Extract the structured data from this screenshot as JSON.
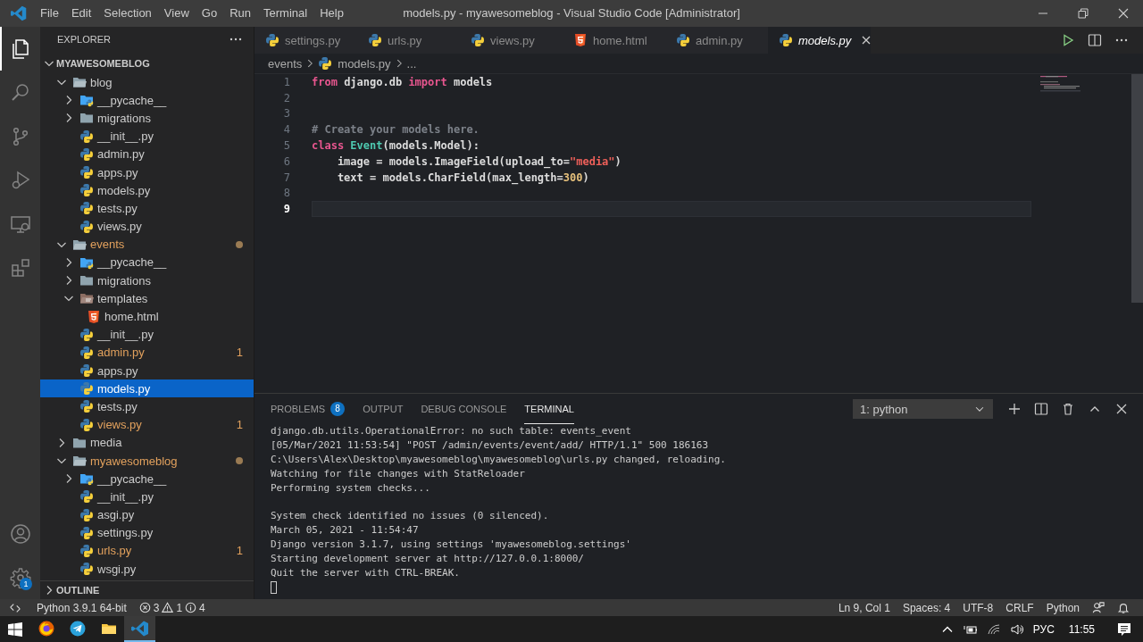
{
  "title_bar": {
    "menu": [
      "File",
      "Edit",
      "Selection",
      "View",
      "Go",
      "Run",
      "Terminal",
      "Help"
    ],
    "title": "models.py - myawesomeblog - Visual Studio Code [Administrator]"
  },
  "activity_bar": {
    "items": [
      {
        "kind": "explorer",
        "selected": true
      },
      {
        "kind": "search",
        "selected": false
      },
      {
        "kind": "source-control",
        "selected": false
      },
      {
        "kind": "run",
        "selected": false
      },
      {
        "kind": "remote",
        "selected": false
      },
      {
        "kind": "extensions",
        "selected": false
      }
    ],
    "bottom": [
      {
        "kind": "account"
      },
      {
        "kind": "manage",
        "badge": "1"
      }
    ]
  },
  "sidebar": {
    "title": "EXPLORER",
    "section": {
      "title": "MYAWESOMEBLOG",
      "expanded": true
    },
    "tree": [
      {
        "name": "blog",
        "kind": "folder",
        "expanded": true,
        "modified": false,
        "selected": false,
        "children": [
          {
            "name": "__pycache__",
            "kind": "pycache",
            "expanded": false,
            "modified": false,
            "selected": false
          },
          {
            "name": "migrations",
            "kind": "folder",
            "expanded": false,
            "modified": false,
            "selected": false
          },
          {
            "name": "__init__.py",
            "kind": "python",
            "modified": false,
            "selected": false
          },
          {
            "name": "admin.py",
            "kind": "python",
            "modified": false,
            "selected": false
          },
          {
            "name": "apps.py",
            "kind": "python",
            "modified": false,
            "selected": false
          },
          {
            "name": "models.py",
            "kind": "python",
            "modified": false,
            "selected": false
          },
          {
            "name": "tests.py",
            "kind": "python",
            "modified": false,
            "selected": false
          },
          {
            "name": "views.py",
            "kind": "python",
            "modified": false,
            "selected": false
          }
        ]
      },
      {
        "name": "events",
        "kind": "folder",
        "expanded": true,
        "modified": true,
        "selected": false,
        "children": [
          {
            "name": "__pycache__",
            "kind": "pycache",
            "expanded": false,
            "modified": false,
            "selected": false
          },
          {
            "name": "migrations",
            "kind": "folder",
            "expanded": false,
            "modified": false,
            "selected": false
          },
          {
            "name": "templates",
            "kind": "templates",
            "expanded": true,
            "modified": false,
            "selected": false,
            "children": [
              {
                "name": "home.html",
                "kind": "html",
                "modified": false,
                "selected": false
              }
            ]
          },
          {
            "name": "__init__.py",
            "kind": "python",
            "modified": false,
            "selected": false
          },
          {
            "name": "admin.py",
            "kind": "python",
            "modified": true,
            "badge": "1",
            "selected": false
          },
          {
            "name": "apps.py",
            "kind": "python",
            "modified": false,
            "selected": false
          },
          {
            "name": "models.py",
            "kind": "python",
            "modified": false,
            "selected": true
          },
          {
            "name": "tests.py",
            "kind": "python",
            "modified": false,
            "selected": false
          },
          {
            "name": "views.py",
            "kind": "python",
            "modified": true,
            "badge": "1",
            "selected": false
          }
        ]
      },
      {
        "name": "media",
        "kind": "folder",
        "expanded": false,
        "modified": false,
        "selected": false
      },
      {
        "name": "myawesomeblog",
        "kind": "folder",
        "expanded": true,
        "modified": true,
        "selected": false,
        "children": [
          {
            "name": "__pycache__",
            "kind": "pycache",
            "expanded": false,
            "modified": false,
            "selected": false
          },
          {
            "name": "__init__.py",
            "kind": "python",
            "modified": false,
            "selected": false
          },
          {
            "name": "asgi.py",
            "kind": "python",
            "modified": false,
            "selected": false
          },
          {
            "name": "settings.py",
            "kind": "python",
            "modified": false,
            "selected": false
          },
          {
            "name": "urls.py",
            "kind": "python",
            "modified": true,
            "badge": "1",
            "selected": false
          },
          {
            "name": "wsgi.py",
            "kind": "python",
            "modified": false,
            "selected": false
          }
        ]
      }
    ],
    "outline": {
      "title": "OUTLINE",
      "expanded": false
    }
  },
  "editor": {
    "tabs": [
      {
        "label": "settings.py",
        "kind": "python",
        "selected": false,
        "preview": false
      },
      {
        "label": "urls.py",
        "kind": "python",
        "selected": false,
        "preview": false
      },
      {
        "label": "views.py",
        "kind": "python",
        "selected": false,
        "preview": false
      },
      {
        "label": "home.html",
        "kind": "html",
        "selected": false,
        "preview": false
      },
      {
        "label": "admin.py",
        "kind": "python",
        "selected": false,
        "preview": false
      },
      {
        "label": "models.py",
        "kind": "python",
        "selected": true,
        "preview": true
      }
    ],
    "breadcrumbs": [
      {
        "text": "events",
        "kind": "folder"
      },
      {
        "text": "models.py",
        "kind": "python"
      },
      {
        "text": "...",
        "kind": "symbol"
      }
    ],
    "lines": [
      {
        "number": "1",
        "current": false,
        "tokens": [
          {
            "kind": "keyword",
            "text": "from"
          },
          {
            "kind": "plain",
            "text": " django.db "
          },
          {
            "kind": "keyword",
            "text": "import"
          },
          {
            "kind": "plain",
            "text": " models"
          }
        ]
      },
      {
        "number": "2",
        "current": false
      },
      {
        "number": "3",
        "current": false
      },
      {
        "number": "4",
        "current": false,
        "tokens": [
          {
            "kind": "comment",
            "text": "# Create your models here."
          }
        ]
      },
      {
        "number": "5",
        "current": false,
        "tokens": [
          {
            "kind": "keyword",
            "text": "class"
          },
          {
            "kind": "class",
            "text": " Event"
          },
          {
            "kind": "plain",
            "text": "(models.Model):"
          }
        ]
      },
      {
        "number": "6",
        "current": false,
        "tokens": [
          {
            "kind": "plain",
            "text": "    image = models.ImageField(upload_to="
          },
          {
            "kind": "string",
            "text": "\"media\""
          },
          {
            "kind": "plain",
            "text": ")"
          }
        ]
      },
      {
        "number": "7",
        "current": false,
        "tokens": [
          {
            "kind": "plain",
            "text": "    text = models.CharField(max_length="
          },
          {
            "kind": "number",
            "text": "300"
          },
          {
            "kind": "plain",
            "text": ")"
          }
        ]
      },
      {
        "number": "8",
        "current": false
      },
      {
        "number": "9",
        "current": true
      }
    ]
  },
  "panel": {
    "tabs": [
      {
        "label": "PROBLEMS",
        "badge": "8",
        "selected": false
      },
      {
        "label": "OUTPUT",
        "selected": false
      },
      {
        "label": "DEBUG CONSOLE",
        "selected": false
      },
      {
        "label": "TERMINAL",
        "selected": true
      }
    ],
    "terminal_selector": "1: python",
    "terminal": {
      "cursor": true,
      "lines": [
        {
          "kind": "output",
          "text": "django.db.utils.OperationalError: no such table: events_event"
        },
        {
          "kind": "output",
          "text": "[05/Mar/2021 11:53:54] \"POST /admin/events/event/add/ HTTP/1.1\" 500 186163"
        },
        {
          "kind": "output",
          "text": "C:\\Users\\Alex\\Desktop\\myawesomeblog\\myawesomeblog\\urls.py changed, reloading."
        },
        {
          "kind": "output",
          "text": "Watching for file changes with StatReloader"
        },
        {
          "kind": "output",
          "text": "Performing system checks..."
        },
        {
          "kind": "blank"
        },
        {
          "kind": "output",
          "text": "System check identified no issues (0 silenced)."
        },
        {
          "kind": "output",
          "text": "March 05, 2021 - 11:54:47"
        },
        {
          "kind": "output",
          "text": "Django version 3.1.7, using settings 'myawesomeblog.settings'"
        },
        {
          "kind": "output",
          "text": "Starting development server at http://127.0.0.1:8000/"
        },
        {
          "kind": "output",
          "text": "Quit the server with CTRL-BREAK."
        }
      ]
    }
  },
  "status_bar": {
    "interpreter": "Python 3.9.1 64-bit",
    "errors": "3",
    "warnings": "1",
    "infos": "4",
    "right": [
      "Ln 9, Col 1",
      "Spaces: 4",
      "UTF-8",
      "CRLF",
      "Python"
    ]
  },
  "taskbar": {
    "apps": [
      {
        "kind": "firefox",
        "selected": false
      },
      {
        "kind": "telegram",
        "selected": false
      },
      {
        "kind": "folder",
        "selected": false
      },
      {
        "kind": "vscode",
        "selected": true
      }
    ],
    "language": "РУС",
    "time": "11:55"
  }
}
